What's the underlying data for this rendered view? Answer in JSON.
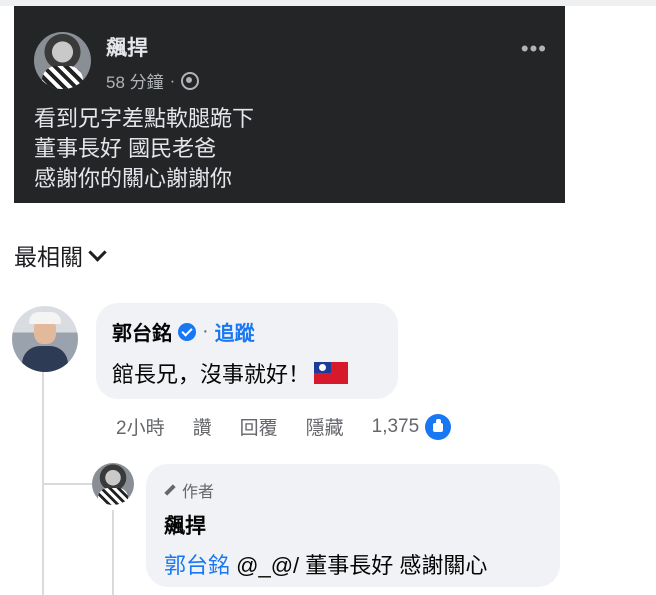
{
  "post": {
    "author": "飆捍",
    "time": "58 分鐘",
    "separator": "·",
    "more": "•••",
    "lines": [
      "看到兄字差點軟腿跪下",
      "董事長好 國民老爸",
      "感謝你的關心謝謝你"
    ]
  },
  "sort": {
    "label": "最相關"
  },
  "comment": {
    "author": "郭台銘",
    "separator": "·",
    "follow": "追蹤",
    "text": "館長兄，沒事就好！",
    "actions": {
      "time": "2小時",
      "like": "讚",
      "reply": "回覆",
      "hide": "隱藏",
      "count": "1,375"
    }
  },
  "reply": {
    "badge": "作者",
    "author": "飆捍",
    "mention": "郭台銘",
    "text": " @_@/ 董事長好 感謝關心"
  },
  "colors": {
    "accent": "#1877f2",
    "post_bg": "#242526",
    "bubble_bg": "#f0f2f5"
  }
}
